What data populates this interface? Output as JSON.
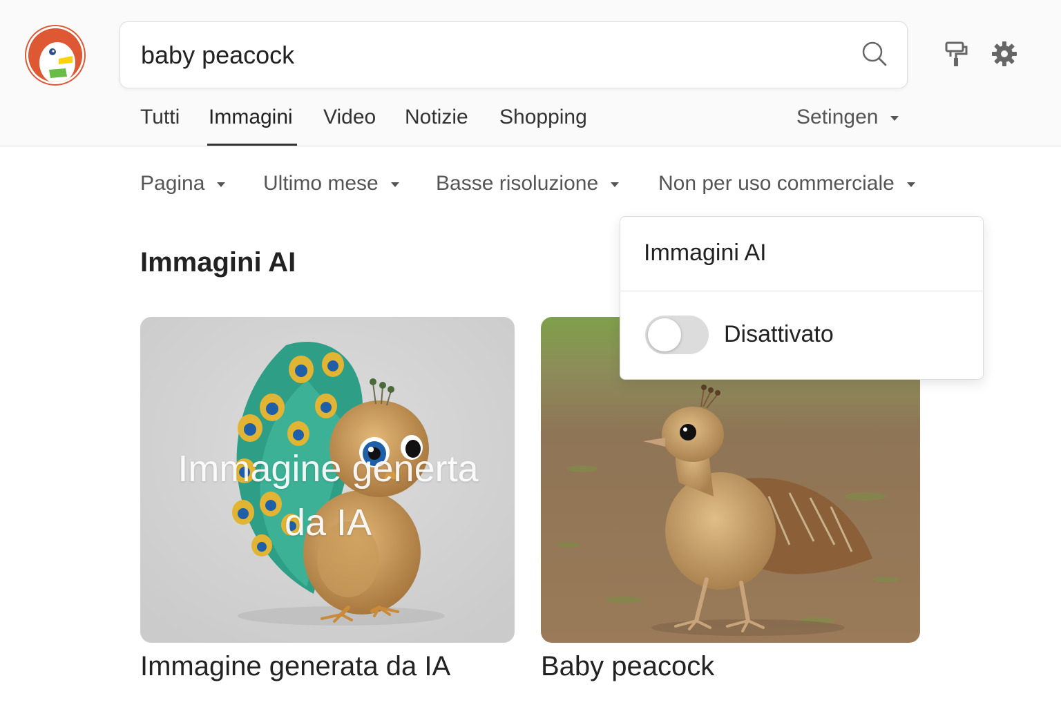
{
  "search": {
    "value": "baby peacock"
  },
  "tabs": [
    {
      "label": "Tutti"
    },
    {
      "label": "Immagini",
      "active": true
    },
    {
      "label": "Video"
    },
    {
      "label": "Notizie"
    },
    {
      "label": "Shopping"
    }
  ],
  "settings_menu": {
    "label": "Setingen"
  },
  "filters": [
    {
      "label": "Pagina"
    },
    {
      "label": "Ultimo mese"
    },
    {
      "label": "Basse risoluzione"
    },
    {
      "label": "Non per uso commerciale"
    }
  ],
  "section": {
    "title": "Immagini AI"
  },
  "results": [
    {
      "overlay": "Immagine generta da IA",
      "caption": "Immagine generata da IA"
    },
    {
      "caption": "Baby peacock"
    }
  ],
  "dropdown": {
    "title": "Immagini AI",
    "toggle_label": "Disattivato",
    "toggle_on": false
  },
  "colors": {
    "brand": "#de5833",
    "tab_indicator": "#333333",
    "toggle_off": "#dcdcdc"
  },
  "icons": [
    "duckduckgo-logo",
    "search-icon",
    "paint-roller-icon",
    "gear-icon"
  ]
}
